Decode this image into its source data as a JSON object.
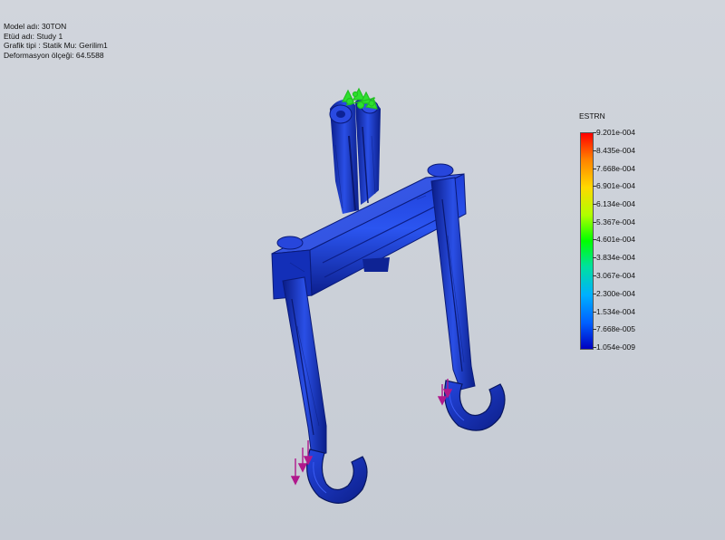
{
  "info": {
    "model_name": "Model adı: 30TON",
    "study_name": "Etüd adı: Study 1",
    "plot_type": "Grafik tipi : Statik Mu: Gerilim1",
    "deformation_scale": "Deformasyon ölçeği: 64.5588"
  },
  "legend": {
    "title": "ESTRN",
    "labels": [
      "9.201e-004",
      "8.435e-004",
      "7.668e-004",
      "6.901e-004",
      "6.134e-004",
      "5.367e-004",
      "4.601e-004",
      "3.834e-004",
      "3.067e-004",
      "2.300e-004",
      "1.534e-004",
      "7.668e-005",
      "1.054e-009"
    ]
  },
  "colors": {
    "background": "#cdd2da",
    "model_blue": "#1a33c8",
    "model_dark": "#0b1f8a",
    "fixture_green": "#2ecc2e",
    "load_magenta": "#b0188c"
  }
}
